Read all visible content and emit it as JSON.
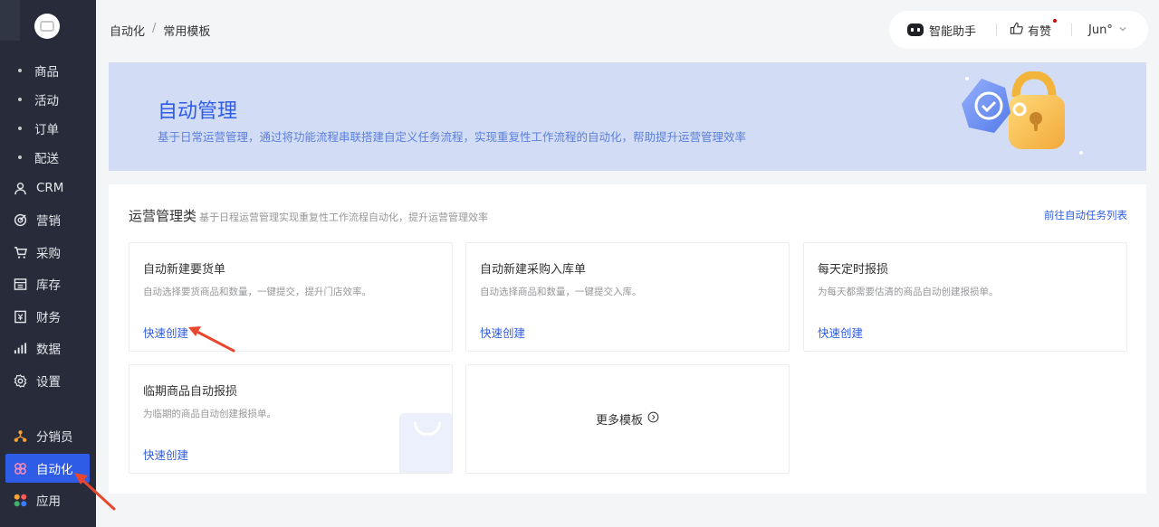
{
  "sidebar": {
    "sub_items": [
      {
        "label": "商品"
      },
      {
        "label": "活动"
      },
      {
        "label": "订单"
      },
      {
        "label": "配送"
      }
    ],
    "items": [
      {
        "label": "CRM",
        "icon": "user-icon"
      },
      {
        "label": "营销",
        "icon": "target-icon"
      },
      {
        "label": "采购",
        "icon": "cart-icon"
      },
      {
        "label": "库存",
        "icon": "warehouse-icon"
      },
      {
        "label": "财务",
        "icon": "finance-icon"
      },
      {
        "label": "数据",
        "icon": "bar-chart-icon"
      },
      {
        "label": "设置",
        "icon": "gear-icon"
      }
    ],
    "bottom_items": [
      {
        "label": "分销员",
        "icon": "network-icon"
      },
      {
        "label": "自动化",
        "icon": "automation-icon",
        "active": true
      },
      {
        "label": "应用",
        "icon": "apps-icon"
      }
    ]
  },
  "breadcrumb": {
    "parent": "自动化",
    "separator": "/",
    "current": "常用模板"
  },
  "topbar": {
    "assistant": "智能助手",
    "like": "有赞",
    "user": "Jun°"
  },
  "banner": {
    "title": "自动管理",
    "description": "基于日常运营管理，通过将功能流程串联搭建自定义任务流程，实现重复性工作流程的自动化，帮助提升运营管理效率"
  },
  "section": {
    "title": "运营管理类",
    "subtitle": "基于日程运营管理实现重复性工作流程自动化，提升运营管理效率",
    "link": "前往自动任务列表"
  },
  "cards": [
    {
      "title": "自动新建要货单",
      "desc": "自动选择要货商品和数量，一键提交，提升门店效率。",
      "action": "快速创建"
    },
    {
      "title": "自动新建采购入库单",
      "desc": "自动选择商品和数量，一键提交入库。",
      "action": "快速创建"
    },
    {
      "title": "每天定时报损",
      "desc": "为每天都需要估清的商品自动创建报损单。",
      "action": "快速创建"
    },
    {
      "title": "临期商品自动报损",
      "desc": "为临期的商品自动创建报损单。",
      "action": "快速创建"
    }
  ],
  "more": {
    "label": "更多模板"
  },
  "colors": {
    "accent": "#2e5ce6",
    "sidebar_bg": "#282c3a",
    "banner_bg": "#d2ddf5",
    "annotation_arrow": "#e8472f"
  }
}
